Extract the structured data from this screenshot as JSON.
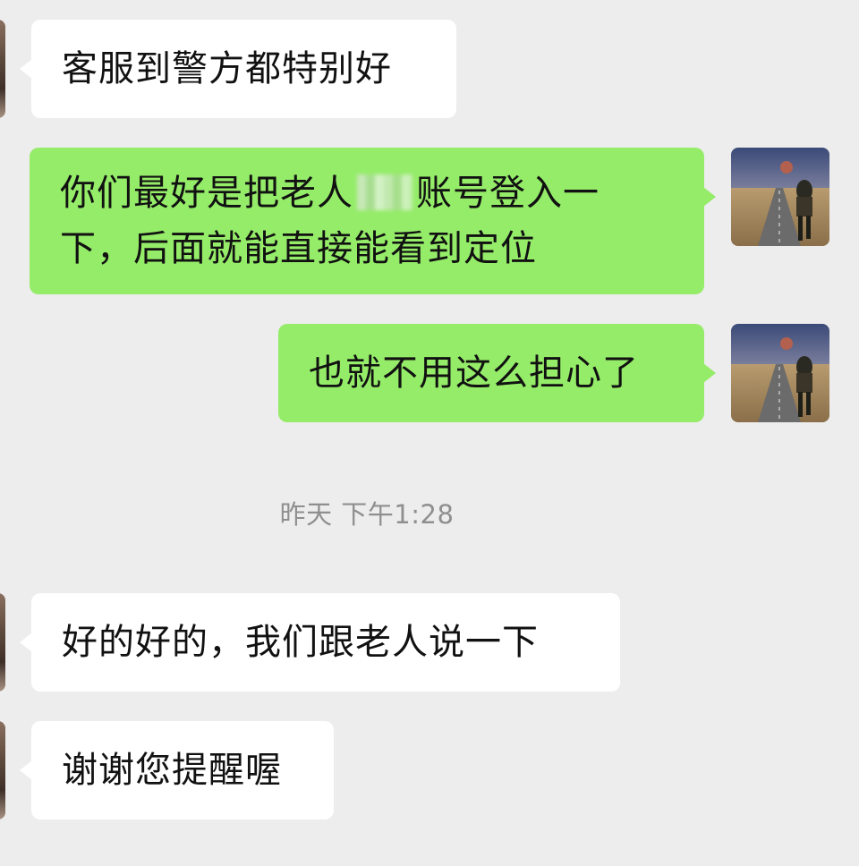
{
  "messages": [
    {
      "side": "incoming",
      "text": "客服到警方都特别好"
    },
    {
      "side": "outgoing",
      "line1_before": "你们最好是把老人",
      "line1_after": "账号登入一",
      "line2": "下，后面就能直接能看到定位"
    },
    {
      "side": "outgoing",
      "text": "也就不用这么担心了"
    },
    {
      "side": "incoming",
      "text": "好的好的，我们跟老人说一下"
    },
    {
      "side": "incoming",
      "text": "谢谢您提醒喔"
    }
  ],
  "timestamp": "昨天 下午1:28",
  "colors": {
    "background": "#ededed",
    "incoming_bubble": "#ffffff",
    "outgoing_bubble": "#95ec69",
    "timestamp_text": "#8f8f8f"
  },
  "icons": {
    "self_avatar": "desert-road-moon-avatar",
    "peer_avatar": "peer-avatar"
  }
}
